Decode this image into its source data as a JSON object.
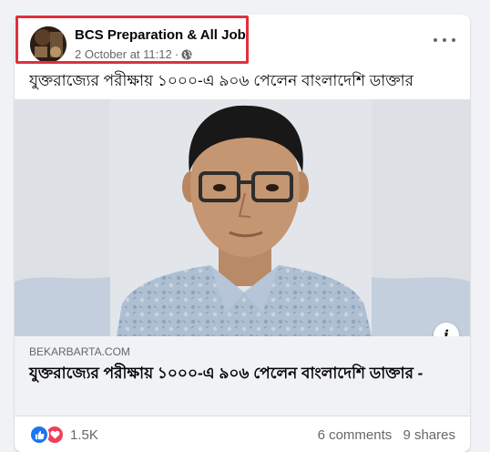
{
  "post": {
    "author": "BCS Preparation & All Job",
    "timestamp": "2 October at 11:12",
    "separator": "·",
    "privacy_icon": "globe-icon",
    "menu_icon": "more-options-icon",
    "text": "যুক্তরাজ্যের পরীক্ষায় ১০০০-এ ৯০৬ পেলেন বাংলাদেশি ডাক্তার"
  },
  "link_preview": {
    "domain": "BEKARBARTA.COM",
    "title": "যুক্তরাজ্যের পরীক্ষায় ১০০০-এ ৯০৬ পেলেন বাংলাদেশি ডাক্তার -",
    "info_label": "i"
  },
  "footer": {
    "reaction_icons": [
      "like-icon",
      "love-icon"
    ],
    "reaction_count": "1.5K",
    "comments": "6 comments",
    "shares": "9 shares"
  },
  "colors": {
    "highlight": "#e0303d",
    "like": "#1877f2",
    "love": "#f33e58",
    "secondary_text": "#65676b"
  }
}
